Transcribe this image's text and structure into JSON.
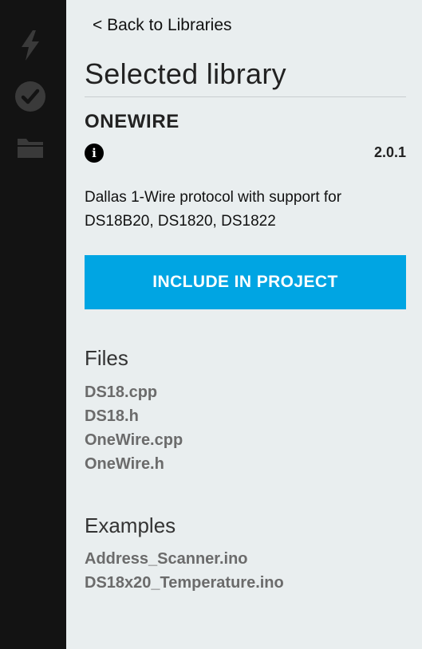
{
  "sidebar": {
    "icons": [
      "lightning-icon",
      "check-circle-icon",
      "folder-icon"
    ]
  },
  "panel": {
    "back_link": "< Back to Libraries",
    "section_title": "Selected library",
    "library": {
      "name": "ONEWIRE",
      "version": "2.0.1",
      "info_icon_glyph": "i",
      "description": "Dallas 1-Wire protocol with support for DS18B20, DS1820, DS1822"
    },
    "include_button": "INCLUDE IN PROJECT",
    "files": {
      "title": "Files",
      "items": [
        "DS18.cpp",
        "DS18.h",
        "OneWire.cpp",
        "OneWire.h"
      ]
    },
    "examples": {
      "title": "Examples",
      "items": [
        "Address_Scanner.ino",
        "DS18x20_Temperature.ino"
      ]
    }
  },
  "colors": {
    "sidebar_bg": "#131313",
    "panel_bg": "#e9eeef",
    "accent": "#00a5e3",
    "sidebar_icon": "#3a3a3a"
  }
}
